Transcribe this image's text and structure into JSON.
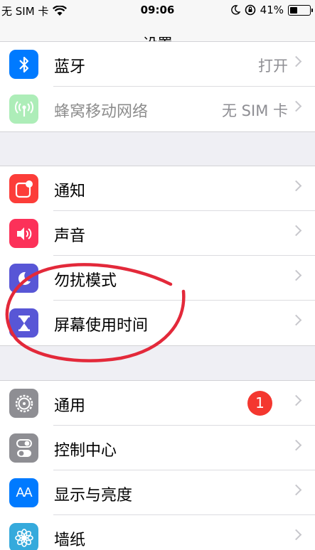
{
  "status_bar": {
    "carrier": "无 SIM 卡",
    "time": "09:06",
    "battery": "41%",
    "battery_level": 0.41
  },
  "nav": {
    "title": "设置"
  },
  "group1": [
    {
      "label": "蓝牙",
      "value": "打开",
      "icon": "bluetooth-icon",
      "color": "#007aff"
    },
    {
      "label": "蜂窝移动网络",
      "value": "无 SIM 卡",
      "icon": "cellular-icon",
      "color": "#4cd964"
    }
  ],
  "group2": [
    {
      "label": "通知",
      "icon": "notifications-icon",
      "color": "#fc3d39"
    },
    {
      "label": "声音",
      "icon": "sounds-icon",
      "color": "#fc3159"
    },
    {
      "label": "勿扰模式",
      "icon": "moon-icon",
      "color": "#5856d6"
    },
    {
      "label": "屏幕使用时间",
      "icon": "hourglass-icon",
      "color": "#5856d6"
    }
  ],
  "group3": [
    {
      "label": "通用",
      "badge": "1",
      "icon": "gear-icon",
      "color": "#8e8e93"
    },
    {
      "label": "控制中心",
      "icon": "toggle-icon",
      "color": "#8e8e93"
    },
    {
      "label": "显示与亮度",
      "icon_text": "AA",
      "icon": "display-icon",
      "color": "#007aff"
    },
    {
      "label": "墙纸",
      "icon": "flower-icon",
      "color": "#35aadc"
    }
  ]
}
